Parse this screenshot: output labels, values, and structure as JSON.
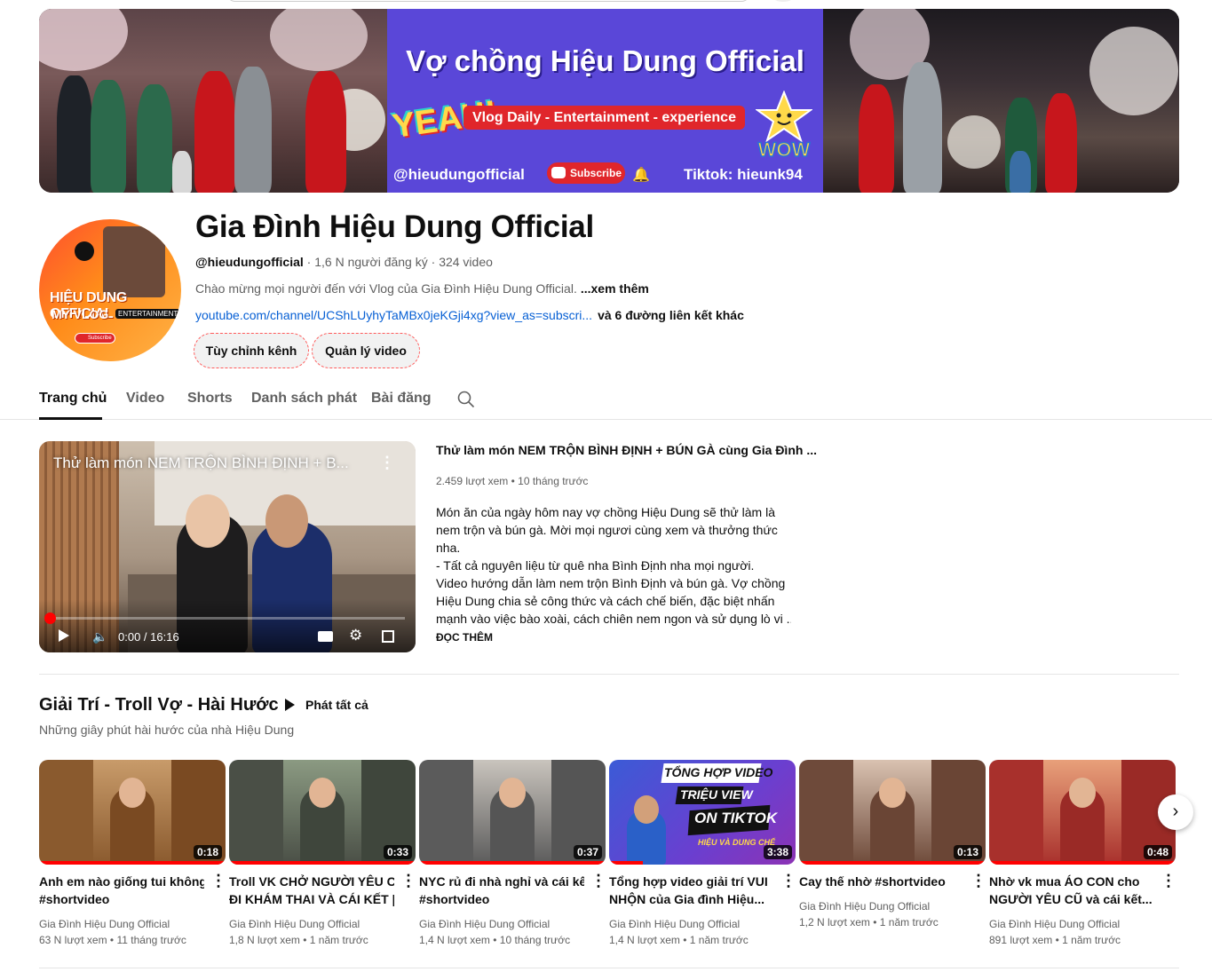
{
  "banner": {
    "title": "Vợ chồng Hiệu Dung Official",
    "tagline": "Vlog Daily - Entertainment - experience",
    "yeah": "YEAH!",
    "wow": "WOW",
    "handle": "@hieudungofficial",
    "subscribe": "Subscribe",
    "tiktok": "Tiktok: hieunk94"
  },
  "avatar": {
    "line1": "HIỆU DUNG OFFICIAL",
    "line2": "MY VLOG",
    "badge": "ENTERTAINMENT",
    "subscribe": "Subscribe"
  },
  "channel": {
    "name": "Gia Đình Hiệu Dung Official",
    "handle": "@hieudungofficial",
    "subscribers": "1,6 N người đăng ký",
    "videos": "324 video",
    "description": "Chào mừng mọi người đến với Vlog của Gia Đình Hiệu Dung Official.",
    "more": "...xem thêm",
    "link": "youtube.com/channel/UCShLUyhyTaMBx0jeKGji4xg?view_as=subscri...",
    "other_links": "và 6 đường liên kết khác",
    "customize_button": "Tùy chỉnh kênh",
    "manage_button": "Quản lý video"
  },
  "tabs": [
    "Trang chủ",
    "Video",
    "Shorts",
    "Danh sách phát",
    "Bài đăng"
  ],
  "featured": {
    "overlay_title": "Thử làm món NEM TRỘN BÌNH ĐỊNH + B...",
    "time": "0:00 / 16:16",
    "progress": 0.01,
    "title": "Thử làm món NEM TRỘN BÌNH ĐỊNH + BÚN GÀ cùng Gia Đình ...",
    "views": "2.459 lượt xem",
    "age": "10 tháng trước",
    "description_lines": [
      "Món ăn của ngày hôm nay vợ chồng Hiệu Dung sẽ thử làm là",
      "nem trộn và bún gà. Mời mọi ngươi cùng xem và thưởng thức",
      "nha.",
      "- Tất cả nguyên liệu từ quê nha Bình Định nha mọi người.",
      "Video hướng dẫn làm nem trộn Bình Định và bún gà. Vợ chồng",
      "Hiệu Dung chia sẻ công thức và cách chế biến, đặc biệt nhấn",
      "mạnh vào việc bào xoài, cách chiên nem ngon và sử dụng lò vi ..."
    ],
    "read_more": "ĐỌC THÊM"
  },
  "playlist": {
    "title": "Giải Trí - Troll Vợ - Hài Hước",
    "play_all": "Phát tất cả",
    "subtitle": "Những giây phút hài hước của nhà Hiệu Dung",
    "cards": [
      {
        "title_lines": [
          "Anh em nào giống tui không?",
          "#shortvideo"
        ],
        "duration": "0:18",
        "channel": "Gia Đình Hiệu Dung Official",
        "views": "63 N lượt xem",
        "age": "11 tháng trước",
        "watched": 1.0,
        "colors": [
          "#8a5a2e",
          "#c89b6a",
          "#7a4a22"
        ]
      },
      {
        "title_lines": [
          "Troll VK CHỞ NGƯỜI YÊU CŨ",
          "ĐI KHÁM THAI VÀ CÁI KẾT |..."
        ],
        "duration": "0:33",
        "channel": "Gia Đình Hiệu Dung Official",
        "views": "1,8 N lượt xem",
        "age": "1 năm trước",
        "watched": 1.0,
        "colors": [
          "#4a4f46",
          "#8b9a82",
          "#3f463c"
        ]
      },
      {
        "title_lines": [
          "NYC rủ đi nhà nghỉ và cái kết",
          "#shortvideo"
        ],
        "duration": "0:37",
        "channel": "Gia Đình Hiệu Dung Official",
        "views": "1,4 N lượt xem",
        "age": "10 tháng trước",
        "watched": 1.0,
        "colors": [
          "#5b5b5b",
          "#c9c4bd",
          "#555555"
        ]
      },
      {
        "title_lines": [
          "Tổng hợp video giải trí VUI",
          "NHỘN của Gia đình Hiệu..."
        ],
        "duration": "3:38",
        "channel": "Gia Đình Hiệu Dung Official",
        "views": "1,4 N lượt xem",
        "age": "1 năm trước",
        "watched": 0.18,
        "colors": [
          "#3b5bd6",
          "#6a3fd0",
          "#8c33b5"
        ],
        "thumb_text": [
          "TỔNG HỢP VIDEO",
          "TRIỆU VIEW",
          "ON TIKTOK",
          "HIỆU VÀ DUNG CHẾ"
        ]
      },
      {
        "title_lines": [
          "Cay thế nhờ #shortvideo"
        ],
        "duration": "0:13",
        "channel": "Gia Đình Hiệu Dung Official",
        "views": "1,2 N lượt xem",
        "age": "1 năm trước",
        "watched": 1.0,
        "colors": [
          "#6e4a3a",
          "#d9c2b1",
          "#6a4535"
        ]
      },
      {
        "title_lines": [
          "Nhờ vk mua ÁO CON cho",
          "NGƯỜI YÊU CŨ và cái kết..."
        ],
        "duration": "0:48",
        "channel": "Gia Đình Hiệu Dung Official",
        "views": "891 lượt xem",
        "age": "1 năm trước",
        "watched": 1.0,
        "colors": [
          "#a8302c",
          "#e8a07a",
          "#9a2a26"
        ]
      }
    ]
  }
}
